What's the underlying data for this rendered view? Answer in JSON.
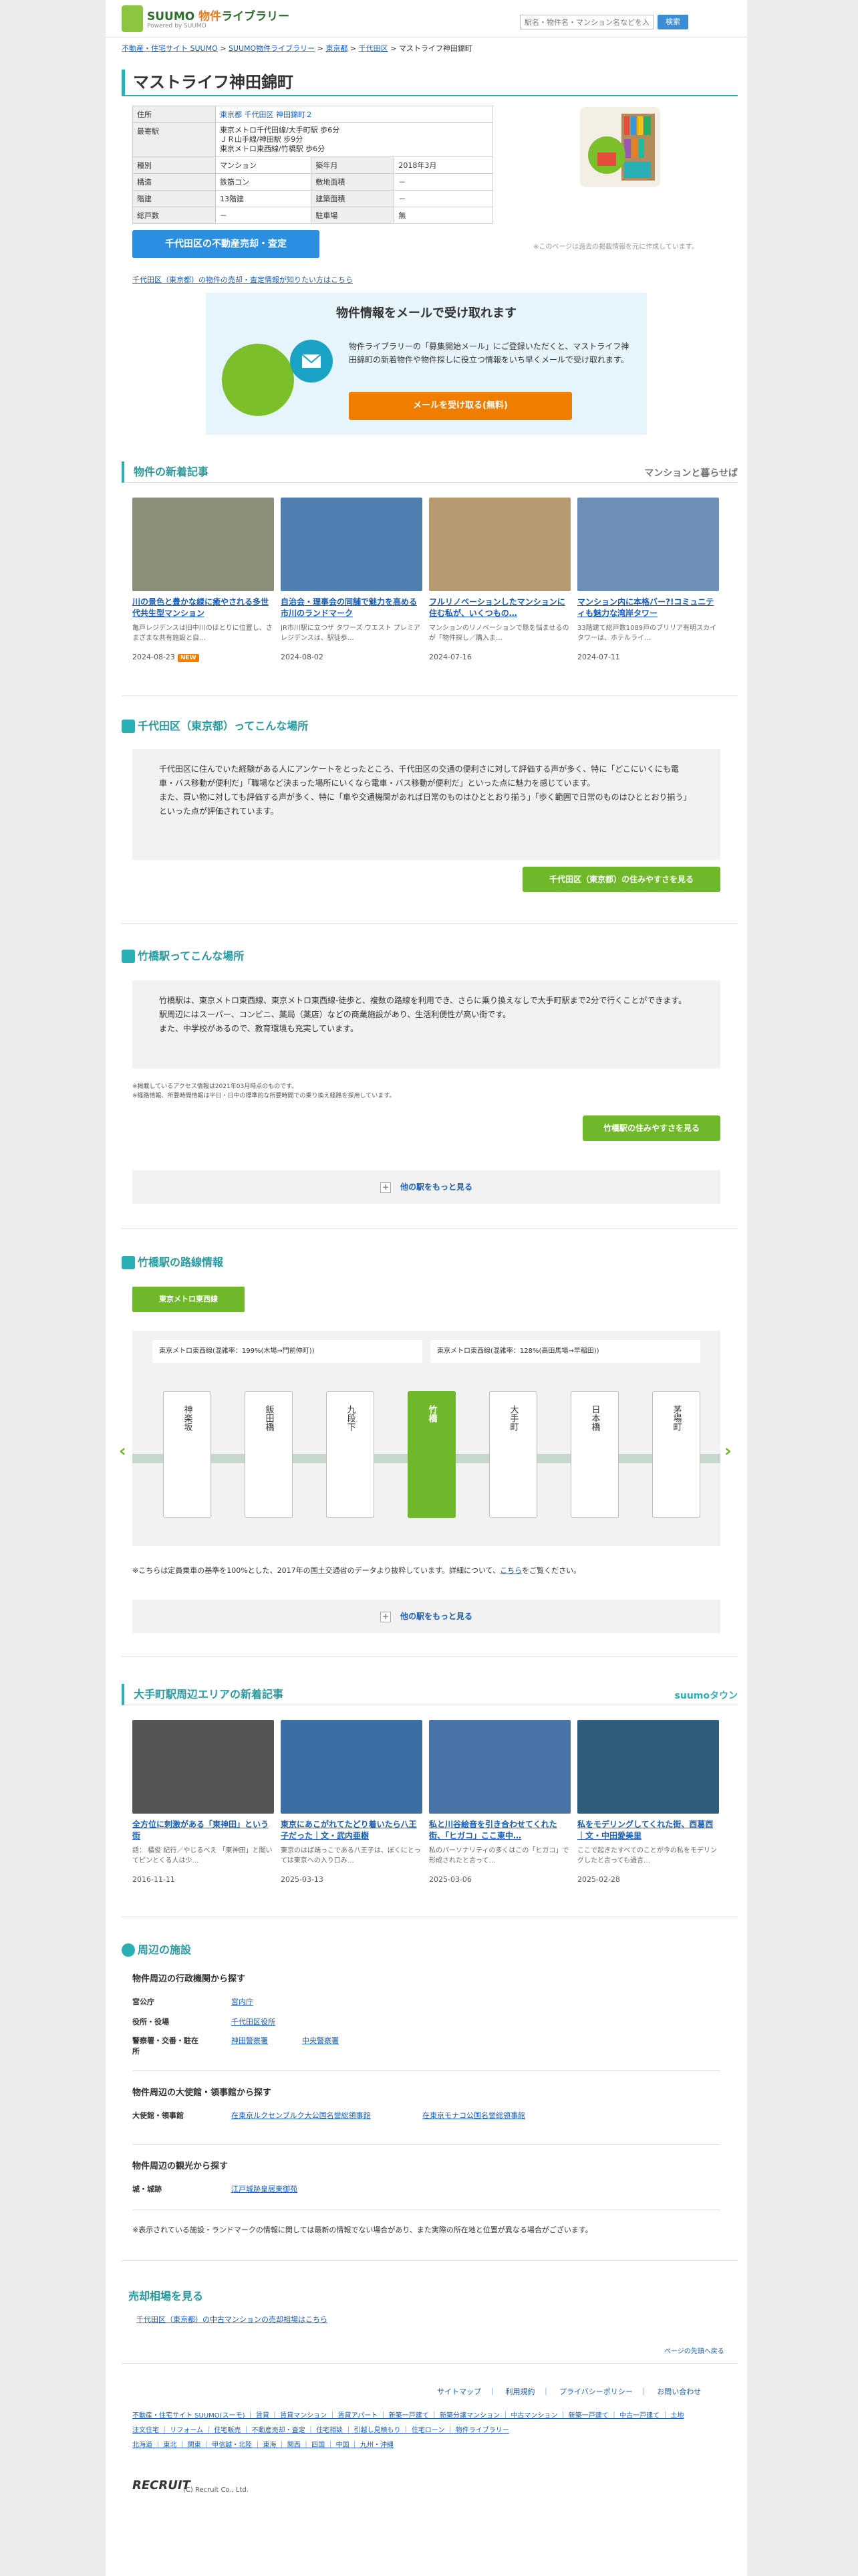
{
  "header": {
    "brand_sub": "物件",
    "brand_main": "ライブラリー",
    "brand_tag": "Powered by SUUMO",
    "search_placeholder": "駅名・物件名・マンション名などを入力",
    "search_button": "検索"
  },
  "breadcrumb": [
    "不動産・住宅サイト SUUMO",
    "SUUMO物件ライブラリー",
    "東京都",
    "千代田区",
    "マストライフ神田錦町"
  ],
  "title": "マストライフ神田錦町",
  "info": {
    "rows": [
      {
        "k": "住所",
        "v": "東京都 千代田区 神田錦町２"
      },
      {
        "k": "最寄駅",
        "v": "東京メトロ千代田線/大手町駅 歩6分\nＪＲ山手線/神田駅 歩9分\n東京メトロ東西線/竹橋駅 歩6分"
      },
      {
        "k": "種別",
        "v": "マンション",
        "k2": "築年月",
        "v2": "2018年3月"
      },
      {
        "k": "構造",
        "v": "鉄筋コン",
        "k2": "敷地面積",
        "v2": "－"
      },
      {
        "k": "階建",
        "v": "13階建",
        "k2": "建築面積",
        "v2": "－"
      },
      {
        "k": "総戸数",
        "v": "－",
        "k2": "駐車場",
        "v2": "無"
      }
    ]
  },
  "cta_sell": "千代田区の不動産売却・査定",
  "note_past": "※このページは過去の掲載情報を元に作成しています。",
  "link_sell": "千代田区（東京都）の物件の売却・査定情報が知りたい方はこちら",
  "mail": {
    "title": "物件情報をメールで受け取れます",
    "text": "物件ライブラリーの「募集開始メール」にご登録いただくと、マストライフ神田錦町の新着物件や物件探しに役立つ情報をいち早くメールで受け取れます。",
    "button": "メールを受け取る(無料)"
  },
  "news": {
    "title": "物件の新着記事",
    "brand": "マンションと暮らせば",
    "items": [
      {
        "t": "川の景色と豊かな緑に癒やされる多世代共生型マンション",
        "d": "亀戸レジデンスは旧中川のほとりに位置し、さまざまな共有施設と自…",
        "date": "2024-08-23",
        "new": "NEW",
        "c": "#8a8f7a"
      },
      {
        "t": "自治会・理事会の同舗で魅力を高める市川のランドマーク",
        "d": "JR市川駅に立つザ タワーズ ウエスト プレミアレジデンスは、駅徒歩…",
        "date": "2024-08-02",
        "c": "#4f7fb0"
      },
      {
        "t": "フルリノベーションしたマンションに住む私が、いくつもの…",
        "d": "マンションのリノベーションで懸を悩ませるのが「物件探し／購入ま…",
        "date": "2024-07-16",
        "c": "#b89a70"
      },
      {
        "t": "マンション内に本格バー?!コミュニティも魅力な湾岸タワー",
        "d": "33階建て総戸数1089戸のブリリア有明スカイタワーは、ホテルライ…",
        "date": "2024-07-11",
        "c": "#6d8fb5"
      }
    ]
  },
  "area": {
    "title": "千代田区（東京都）ってこんな場所",
    "text": "千代田区に住んでいた経験がある人にアンケートをとったところ、千代田区の交通の便利さに対して評価する声が多く、特に「どこにいくにも電車・バス移動が便利だ」「職場など決まった場所にいくなら電車・バス移動が便利だ」といった点に魅力を感じています。\nまた、買い物に対しても評価する声が多く、特に「車や交通機関があれば日常のものはひととおり揃う」「歩く範囲で日常のものはひととおり揃う」といった点が評価されています。",
    "button": "千代田区（東京都）の住みやすさを見る"
  },
  "station": {
    "title": "竹橋駅ってこんな場所",
    "text": "竹橋駅は、東京メトロ東西線、東京メトロ東西線-徒歩と、複数の路線を利用でき、さらに乗り換えなしで大手町駅まで2分で行くことができます。\n駅周辺にはスーパー、コンビニ、薬局（薬店）などの商業施設があり、生活利便性が高い街です。\nまた、中学校があるので、教育環境も充実しています。",
    "note1": "※掲載しているアクセス情報は2021年03月時点のものです。",
    "note2": "※経路情報、所要時間情報は平日・日中の標準的な所要時間での乗り換え経路を採用しています。",
    "button": "竹橋駅の住みやすさを見る",
    "more": "他の駅をもっと見る"
  },
  "route": {
    "title": "竹橋駅の路線情報",
    "tab": "東京メトロ東西線",
    "left": "東京メトロ東西線(混雑率：199%(木場→門前仲町))",
    "right": "東京メトロ東西線(混雑率：128%(高田馬場→早稲田))",
    "stations": [
      "神楽坂",
      "飯田橋",
      "九段下",
      "竹橋",
      "大手町",
      "日本橋",
      "茅場町"
    ],
    "note": "※こちらは定員乗車の基準を100%とした、2017年の国土交通省のデータより抜粋しています。詳細について、",
    "note_link": "こちら",
    "note_end": "をご覧ください。",
    "more": "他の駅をもっと見る"
  },
  "town": {
    "title": "大手町駅周辺エリアの新着記事",
    "brand": "suumoタウン",
    "items": [
      {
        "t": "全方位に刺激がある「東神田」という街",
        "d": "話：  橘俊 紀行／やじるべえ 「東神田」と聞いてピンとくる人は少…",
        "date": "2016-11-11",
        "c": "#555"
      },
      {
        "t": "東京にあこがれてたどり着いたら八王子だった｜文・武内亜樹",
        "d": "東京のはば端っこである八王子は、ぼくにとっては東京への入り口み…",
        "date": "2025-03-13",
        "c": "#3a6ea5"
      },
      {
        "t": "私と川谷絵音を引き合わせてくれた街、「ヒガコ」ここ東中…",
        "d": "私のパーソナリティの多くはこの「ヒガコ」で形成されたと言って…",
        "date": "2025-03-06",
        "c": "#4a74a8"
      },
      {
        "t": "私をモデリングしてくれた街、西葛西｜文・中田愛美里",
        "d": "ここで起きたすべてのことが今の私をモデリングしたと言っても過言…",
        "date": "2025-02-28",
        "c": "#2f5e7c"
      }
    ]
  },
  "facilities": {
    "title": "周辺の施設",
    "g1": "物件周辺の行政機関から探す",
    "g1rows": [
      {
        "k": "宮公庁",
        "v": [
          "宮内庁"
        ]
      },
      {
        "k": "役所・役場",
        "v": [
          "千代田区役所"
        ]
      },
      {
        "k": "警察署・交番・駐在所",
        "v": [
          "神田警察署",
          "中央警察署"
        ]
      }
    ],
    "g2": "物件周辺の大使館・領事館から探す",
    "g2rows": [
      {
        "k": "大使館・領事館",
        "v": [
          "在東京ルクセンブルク大公国名誉総領事館",
          "在東京モナコ公国名誉総領事館"
        ]
      }
    ],
    "g3": "物件周辺の観光から探す",
    "g3rows": [
      {
        "k": "城・城跡",
        "v": [
          "江戸城跡皇居東御苑"
        ]
      }
    ],
    "note": "※表示されている施設・ランドマークの情報に関しては最新の情報でない場合があり、また実際の所在地と位置が異なる場合がございます。"
  },
  "sale": {
    "title": "売却相場を見る",
    "link": "千代田区（東京都）の中古マンションの売却相場はこちら"
  },
  "pagetop": "ページの先頭へ戻る",
  "footer": {
    "links": [
      "サイトマップ",
      "利用規約",
      "プライバシーポリシー",
      "お問い合わせ"
    ],
    "line1": "不動産・住宅サイト SUUMO(スーモ) ｜ 賃貸 ｜ 賃貸マンション ｜ 賃貸アパート ｜ 新築一戸建て ｜ 新築分譲マンション ｜ 中古マンション ｜ 新築一戸建て ｜ 中古一戸建て ｜ 土地",
    "line2": "注文住宅 ｜ リフォーム ｜ 住宅販売 ｜ 不動産売却・査定 ｜ 住宅相談 ｜ 引越し見積もり ｜ 住宅ローン ｜ 物件ライブラリー",
    "line3": "北海道 ｜ 東北 ｜ 関東 ｜ 甲信越・北陸 ｜ 東海 ｜ 関西 ｜ 四国 ｜ 中国 ｜ 九州・沖縄",
    "brand": "RECRUIT",
    "copy": "(C) Recruit Co., Ltd."
  }
}
